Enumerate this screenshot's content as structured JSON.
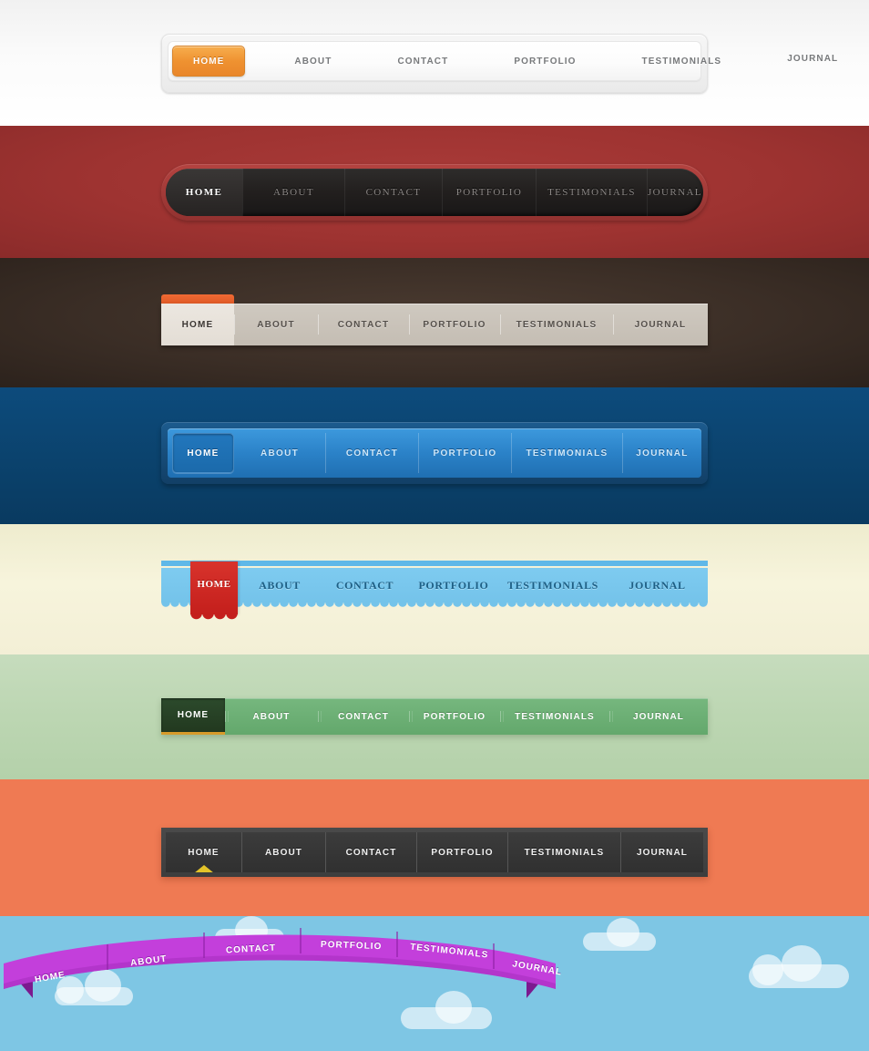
{
  "items": [
    "HOME",
    "ABOUT",
    "CONTACT",
    "PORTFOLIO",
    "TESTIMONIALS",
    "JOURNAL"
  ],
  "navbars": [
    {
      "id": "nav-light-glossy",
      "style_name": "light-glossy",
      "active": "HOME",
      "accent": "#ef9231",
      "background": "#f7f7f7",
      "items": [
        "HOME",
        "ABOUT",
        "CONTACT",
        "PORTFOLIO",
        "TESTIMONIALS",
        "JOURNAL"
      ]
    },
    {
      "id": "nav-dark-pill",
      "style_name": "dark-pill-on-red",
      "active": "HOME",
      "accent": "#a93a38",
      "background": "#9e3331",
      "has_dropdown": true,
      "dropdown_icon": "chevron-down-icon",
      "items": [
        "HOME",
        "ABOUT",
        "CONTACT",
        "PORTFOLIO",
        "TESTIMONIALS",
        "JOURNAL"
      ]
    },
    {
      "id": "nav-tab-brown",
      "style_name": "beige-tab-on-brown",
      "active": "HOME",
      "accent": "#e05a26",
      "background": "#3b2e26",
      "items": [
        "HOME",
        "ABOUT",
        "CONTACT",
        "PORTFOLIO",
        "TESTIMONIALS",
        "JOURNAL"
      ]
    },
    {
      "id": "nav-blue",
      "style_name": "blue-inset",
      "active": "HOME",
      "accent": "#2b82c8",
      "background": "#0b436e",
      "items": [
        "HOME",
        "ABOUT",
        "CONTACT",
        "PORTFOLIO",
        "TESTIMONIALS",
        "JOURNAL"
      ]
    },
    {
      "id": "nav-awning",
      "style_name": "scalloped-awning",
      "active": "HOME",
      "accent": "#c41f1c",
      "background": "#f4f1d7",
      "items": [
        "HOME",
        "ABOUT",
        "CONTACT",
        "PORTFOLIO",
        "TESTIMONIALS",
        "JOURNAL"
      ]
    },
    {
      "id": "nav-green",
      "style_name": "green-flat",
      "active": "HOME",
      "accent": "#d79b2a",
      "background": "#bcd6b2",
      "items": [
        "HOME",
        "ABOUT",
        "CONTACT",
        "PORTFOLIO",
        "TESTIMONIALS",
        "JOURNAL"
      ]
    },
    {
      "id": "nav-dark-segment",
      "style_name": "dark-segmented",
      "active": "HOME",
      "accent": "#e3c329",
      "background": "#ef7a53",
      "indicator_icon": "triangle-up-icon",
      "items": [
        "HOME",
        "ABOUT",
        "CONTACT",
        "PORTFOLIO",
        "TESTIMONIALS",
        "JOURNAL"
      ]
    },
    {
      "id": "nav-purple-ribbon",
      "style_name": "curved-purple-ribbon",
      "active": "HOME",
      "accent": "#c33fdb",
      "background": "#7ec6e4",
      "decor_icon": "cloud-icon",
      "items": [
        "HOME",
        "ABOUT",
        "CONTACT",
        "PORTFOLIO",
        "TESTIMONIALS",
        "JOURNAL"
      ]
    }
  ]
}
